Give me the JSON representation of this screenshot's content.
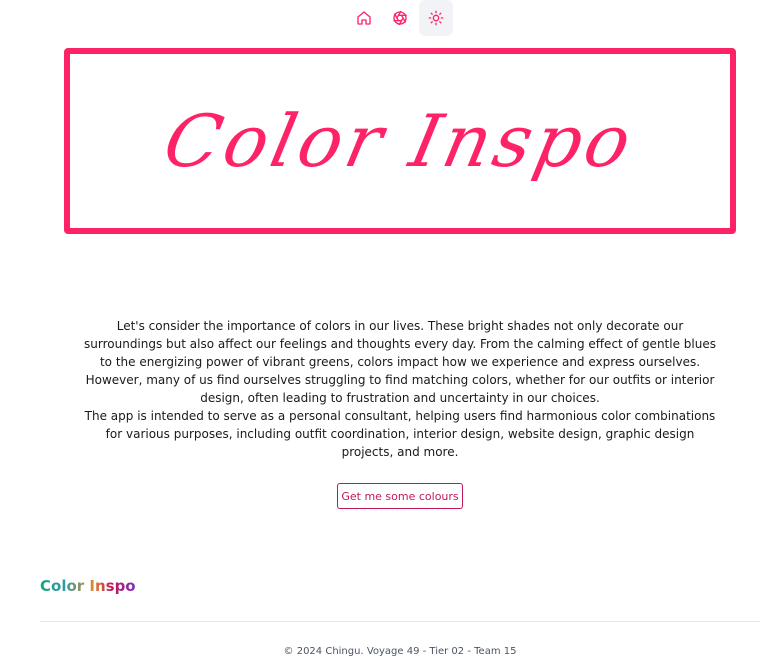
{
  "nav": {
    "items": [
      {
        "icon": "home-icon",
        "active": false
      },
      {
        "icon": "aperture-icon",
        "active": false
      },
      {
        "icon": "sun-icon",
        "active": true
      }
    ],
    "accent": "#fe2266"
  },
  "hero": {
    "title": "Color Inspo",
    "border_color": "#fe2266"
  },
  "intro": {
    "paragraph1": "Let's consider the importance of colors in our lives. These bright shades not only decorate our surroundings but also affect our feelings and thoughts every day. From the calming effect of gentle blues to the energizing power of vibrant greens, colors impact how we experience and express ourselves. However, many of us find ourselves struggling to find matching colors, whether for our outfits or interior design, often leading to frustration and uncertainty in our choices.",
    "paragraph2": "The app is intended to serve as a personal consultant, helping users find harmonious color combinations for various purposes, including outfit coordination, interior design, website design, graphic design projects, and more."
  },
  "cta": {
    "label": "Get me some colours"
  },
  "footer": {
    "logo": "Color Inspo",
    "copyright": "© 2024 Chingu. Voyage 49 - Tier 02 - Team 15"
  }
}
